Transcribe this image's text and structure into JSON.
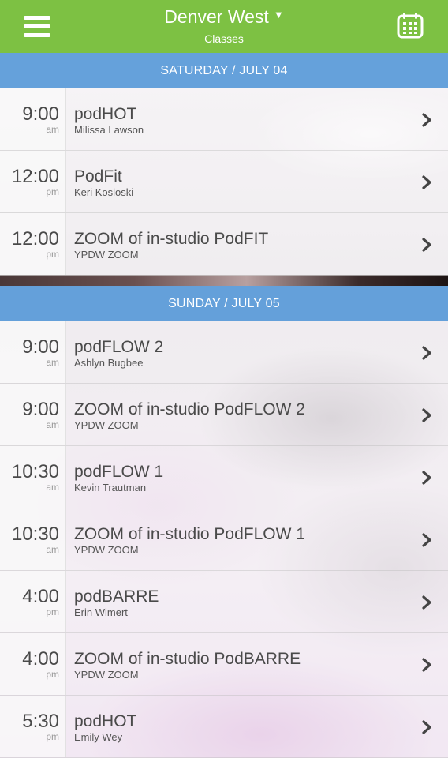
{
  "header": {
    "title": "Denver West",
    "subtitle": "Classes",
    "menu_icon": "hamburger-menu-icon",
    "calendar_icon": "calendar-icon",
    "dropdown_icon": "caret-down-icon",
    "color": "#7dc143"
  },
  "days": [
    {
      "label": "SATURDAY / JULY 04",
      "classes": [
        {
          "time": "9:00",
          "ampm": "am",
          "name": "podHOT",
          "instructor": "Milissa Lawson"
        },
        {
          "time": "12:00",
          "ampm": "pm",
          "name": "PodFit",
          "instructor": "Keri Kosloski"
        },
        {
          "time": "12:00",
          "ampm": "pm",
          "name": "ZOOM of in-studio PodFIT",
          "instructor": "YPDW ZOOM"
        }
      ]
    },
    {
      "label": "SUNDAY / JULY 05",
      "classes": [
        {
          "time": "9:00",
          "ampm": "am",
          "name": "podFLOW 2",
          "instructor": "Ashlyn Bugbee"
        },
        {
          "time": "9:00",
          "ampm": "am",
          "name": "ZOOM of in-studio PodFLOW 2",
          "instructor": "YPDW ZOOM"
        },
        {
          "time": "10:30",
          "ampm": "am",
          "name": "podFLOW 1",
          "instructor": "Kevin Trautman"
        },
        {
          "time": "10:30",
          "ampm": "am",
          "name": "ZOOM of in-studio PodFLOW 1",
          "instructor": "YPDW ZOOM"
        },
        {
          "time": "4:00",
          "ampm": "pm",
          "name": "podBARRE",
          "instructor": "Erin Wimert"
        },
        {
          "time": "4:00",
          "ampm": "pm",
          "name": "ZOOM of in-studio PodBARRE",
          "instructor": "YPDW ZOOM"
        },
        {
          "time": "5:30",
          "ampm": "pm",
          "name": "podHOT",
          "instructor": "Emily Wey"
        }
      ]
    }
  ],
  "day_header_color": "#5f9dda",
  "row_icon": "chevron-right-icon"
}
